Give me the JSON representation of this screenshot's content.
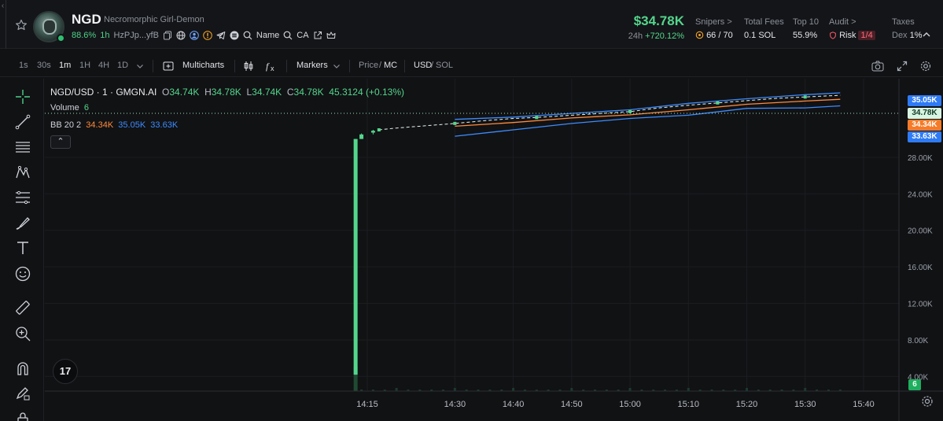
{
  "header": {
    "collapse_glyph": "‹",
    "ticker": "NGD",
    "full_name": "Necromorphic Girl-Demon",
    "holder_pct": "88.6%",
    "age": "1h",
    "address": "HzPJp...yfB",
    "name_search": "Name",
    "ca_search": "CA",
    "price": "$34.78K",
    "change_period": "24h",
    "change_value": "+720.12%",
    "stats": {
      "snipers_label": "Snipers >",
      "snipers_value": "66 / 70",
      "fees_label": "Total Fees",
      "fees_value": "0.1 SOL",
      "top10_label": "Top 10",
      "top10_value": "55.9%",
      "audit_label": "Audit >",
      "risk_label": "Risk",
      "risk_value": "1/4",
      "taxes_label": "Taxes",
      "dex_label": "Dex",
      "dex_value": "1%"
    }
  },
  "toolbar": {
    "timeframes": [
      "1s",
      "30s",
      "1m",
      "1H",
      "4H",
      "1D"
    ],
    "active_timeframe": "1m",
    "multicharts": "Multicharts",
    "markers": "Markers",
    "price": "Price",
    "mc": "MC",
    "usd": "USD",
    "sol": "SOL",
    "slash": "/"
  },
  "chart": {
    "pair_title": "NGD/USD · 1 · GMGN.AI",
    "ohlc": {
      "o_label": "O",
      "o": "34.74K",
      "h_label": "H",
      "h": "34.78K",
      "l_label": "L",
      "l": "34.74K",
      "c_label": "C",
      "c": "34.78K",
      "change": "45.3124 (+0.13%)"
    },
    "volume_label": "Volume",
    "volume_value": "6",
    "bb_label": "BB",
    "bb_params": "20 2",
    "bb_mid": "34.34K",
    "bb_upper": "35.05K",
    "bb_lower": "33.63K",
    "collapse_glyph": "⌃",
    "tv_logo": "17",
    "colors": {
      "up": "#54d68d",
      "bb_mid": "#ff8a3d",
      "bb_band": "#3d8bff",
      "volume": "#22c55e"
    },
    "scale_tags": {
      "upper": "35.05K",
      "last": "34.78K",
      "mid": "34.34K",
      "lower": "33.63K",
      "volume": "6"
    }
  },
  "chart_data": {
    "type": "candlestick",
    "y_axis_labels": [
      "4.00K",
      "8.00K",
      "12.00K",
      "16.00K",
      "20.00K",
      "24.00K",
      "28.00K"
    ],
    "ylim": [
      2400,
      36600
    ],
    "x_axis_labels": [
      "14:15",
      "14:30",
      "14:40",
      "14:50",
      "15:00",
      "15:10",
      "15:20",
      "15:30",
      "15:40"
    ],
    "series": [
      {
        "name": "NGD/USD",
        "x": [
          "14:13",
          "14:14",
          "14:16"
        ],
        "open": [
          4200,
          30000,
          30700
        ],
        "high": [
          30000,
          30600,
          31000
        ],
        "low": [
          4200,
          30000,
          30500
        ],
        "close": [
          30000,
          30500,
          30900
        ]
      }
    ],
    "price_path": {
      "x": [
        "14:17",
        "14:20",
        "14:25",
        "14:30",
        "14:35",
        "14:40",
        "14:44",
        "14:50",
        "14:55",
        "15:00",
        "15:05",
        "15:10",
        "15:15",
        "15:20",
        "15:25",
        "15:30",
        "15:36"
      ],
      "y": [
        31000,
        31200,
        31450,
        31700,
        32000,
        32250,
        32350,
        32600,
        32800,
        33000,
        33400,
        33700,
        33950,
        34200,
        34450,
        34600,
        34780
      ]
    },
    "bollinger": {
      "x": [
        "14:30",
        "14:40",
        "14:50",
        "15:00",
        "15:10",
        "15:20",
        "15:30",
        "15:36"
      ],
      "upper": [
        32150,
        32400,
        32800,
        33200,
        33900,
        34400,
        34850,
        35050
      ],
      "middle": [
        31400,
        31800,
        32300,
        32650,
        33200,
        33800,
        34150,
        34340
      ],
      "lower": [
        30300,
        31000,
        31700,
        32250,
        32600,
        33350,
        33400,
        33630
      ]
    },
    "last_price": 34780,
    "volume_last": 6
  }
}
